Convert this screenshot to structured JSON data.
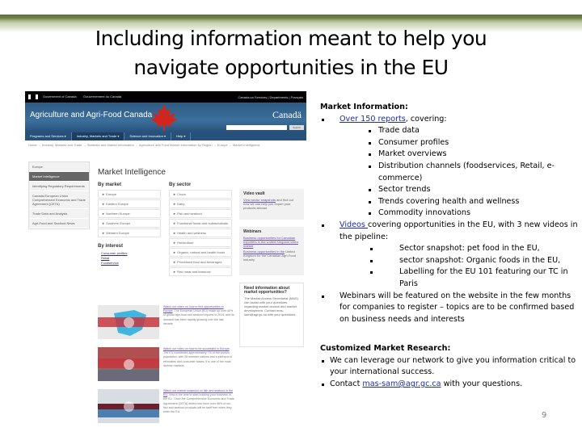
{
  "slide": {
    "title_line1": "Including information meant to help you",
    "title_line2": "navigate opportunities in the EU",
    "page_number": "9"
  },
  "screenshot": {
    "gov_en": "Government of Canada",
    "gov_fr": "Gouvernement du Canada",
    "top_links": "Canada.ca   Services  |  Departments  |  Français",
    "department": "Agriculture and Agri-Food Canada",
    "wordmark": "Canadä",
    "search_button": "Search",
    "nav": [
      "Programs and Services ▾",
      "Industry, Markets and Trade ▾",
      "Science and Innovation ▾",
      "Help ▾"
    ],
    "breadcrumb": "Home → Industry, Markets and Trade → Statistics and Market Information → Agriculture and Food Market Information by Region → Europe → Market Intelligence",
    "left_nav": [
      "Europe",
      "Market Intelligence",
      "Identifying Regulatory Requirements",
      "Canada-European Union Comprehensive Economic and Trade Agreement (CETA)",
      "Trade Data and Analysis",
      "Agri-Food and Seafood News"
    ],
    "page_heading": "Market Intelligence",
    "by_market_heading": "By market",
    "by_market": [
      "► Europe",
      "► Eastern Europe",
      "► Northern Europe",
      "► Southern Europe",
      "► Western Europe"
    ],
    "by_interest_heading": "By interest",
    "by_interest": [
      "Consumer profiles",
      "Retail",
      "Foodservice"
    ],
    "by_sector_heading": "By sector",
    "by_sector": [
      "► Crops",
      "► Dairy",
      "► Fish and seafood",
      "► Functional foods and nutraceuticals",
      "► Health and wellness",
      "► Horticulture",
      "► Organic, natural and health foods",
      "► Processed food and beverages",
      "► Red meat and livestock"
    ],
    "video_vault_heading": "Video vault",
    "video_vault_link": "View sector snapshots",
    "video_vault_text": " and find out how we can help you export your products abroad.",
    "webinars_heading": "Webinars",
    "webinar_1": "Business opportunities for Canadian exporters in the United Kingdom video market",
    "webinar_2_link": "Business opportunities in the",
    "webinar_2_text": " United Kingdom for the Canadian Agri-Food industry",
    "need_info_heading": "Need information about market opportunities?",
    "need_info_text": "The Market Access Secretariat (MAS) can assist with your questions regarding market access and market development. Contact mas-sam@agr.gc.ca with your questions.",
    "videos": [
      {
        "link": "Watch our video on how to find opportunities in Europe",
        "text": ". The European Union (EU) made up over 40% of global agri-food and seafood imports in 2014, and its demand has been rapidly growing over the last decade."
      },
      {
        "link": "Watch our video on how to be successful in Europe",
        "text": ". The EU constitutes approximately 7% of the world's population, with 28 member nations and a plethora of ethnicities and consumer bases, it is one of the most diverse markets."
      },
      {
        "link": "Watch our market snapshot on fish and seafood in the EU",
        "text": ". Now is the time to start building your business in the EU. Once the Comprehensive Economic and Trade Agreement (CETA) enters into force over 96% of our fish and seafood products will be tariff free when they enter the EU."
      }
    ]
  },
  "market_info": {
    "heading": "Market Information:",
    "reports_link": "Over 150 reports",
    "reports_suffix": ", covering:",
    "report_topics": [
      "Trade data",
      "Consumer profiles",
      "Market overviews",
      "Distribution channels (foodservices, Retail, e-commerce)",
      "Sector trends",
      "Trends covering health and wellness",
      "Commodity innovations"
    ],
    "videos_link": "Videos ",
    "videos_text": "covering opportunities in the EU, with 3 new videos in the pipeline:",
    "pipeline_videos": [
      "Sector snapshot: pet food in the EU,",
      "sector snapshot: Organic foods in the EU,",
      "Labelling for the EU 101 featuring our TC in Paris"
    ],
    "webinars_text": "Webinars will be featured on the website in the few months for companies to register – topics are to be confirmed based on business needs and interests"
  },
  "custom_research": {
    "heading": "Customized Market Research:",
    "bullet_1": "We can leverage our network to give you information critical to your international success.",
    "contact_prefix": "Contact ",
    "contact_email": "mas-sam@agr.gc.ca",
    "contact_suffix": " with your questions."
  }
}
